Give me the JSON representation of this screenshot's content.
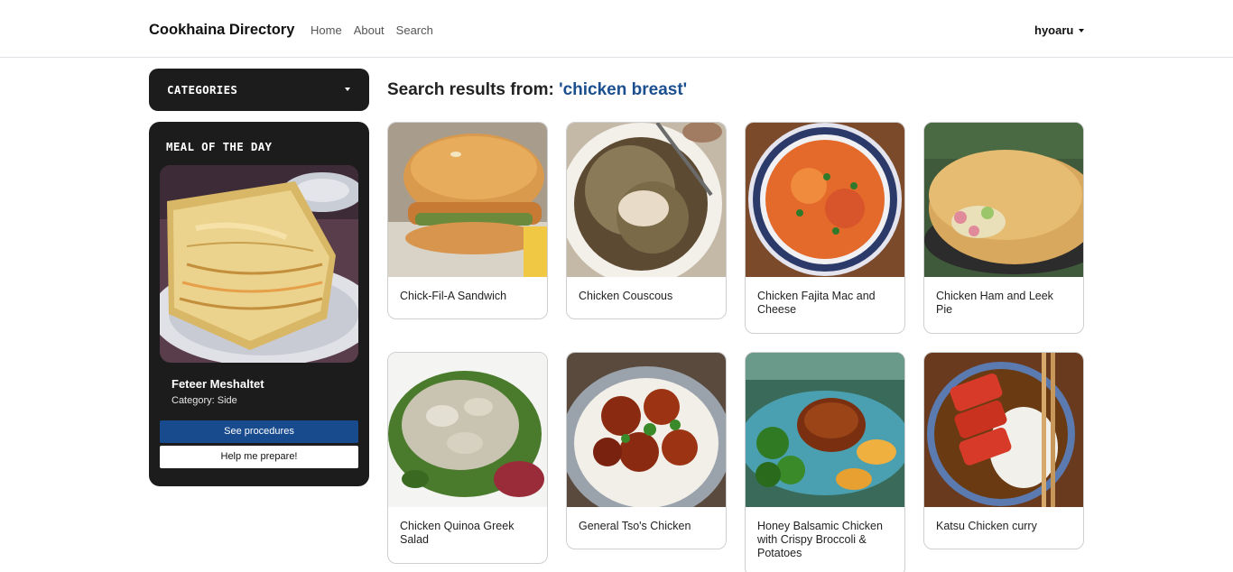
{
  "navbar": {
    "brand": "Cookhaina Directory",
    "links": [
      "Home",
      "About",
      "Search"
    ],
    "user": "hyoaru"
  },
  "sidebar": {
    "categories_label": "CATEGORIES",
    "meal_of_the_day": {
      "heading": "MEAL OF THE DAY",
      "name": "Feteer Meshaltet",
      "category": "Category: Side",
      "see_procedures": "See procedures",
      "help_prepare": "Help me prepare!"
    }
  },
  "results": {
    "prefix": "Search results from: ",
    "query": "'chicken breast'",
    "items": [
      {
        "title": "Chick-Fil-A Sandwich"
      },
      {
        "title": "Chicken Couscous"
      },
      {
        "title": "Chicken Fajita Mac and Cheese"
      },
      {
        "title": "Chicken Ham and Leek Pie"
      },
      {
        "title": "Chicken Quinoa Greek Salad"
      },
      {
        "title": "General Tso's Chicken"
      },
      {
        "title": "Honey Balsamic Chicken with Crispy Broccoli & Potatoes"
      },
      {
        "title": "Katsu Chicken curry"
      }
    ]
  },
  "colors": {
    "dark_panel": "#1c1c1c",
    "accent_blue": "#184a8e",
    "query_blue": "#1c4f8f"
  }
}
